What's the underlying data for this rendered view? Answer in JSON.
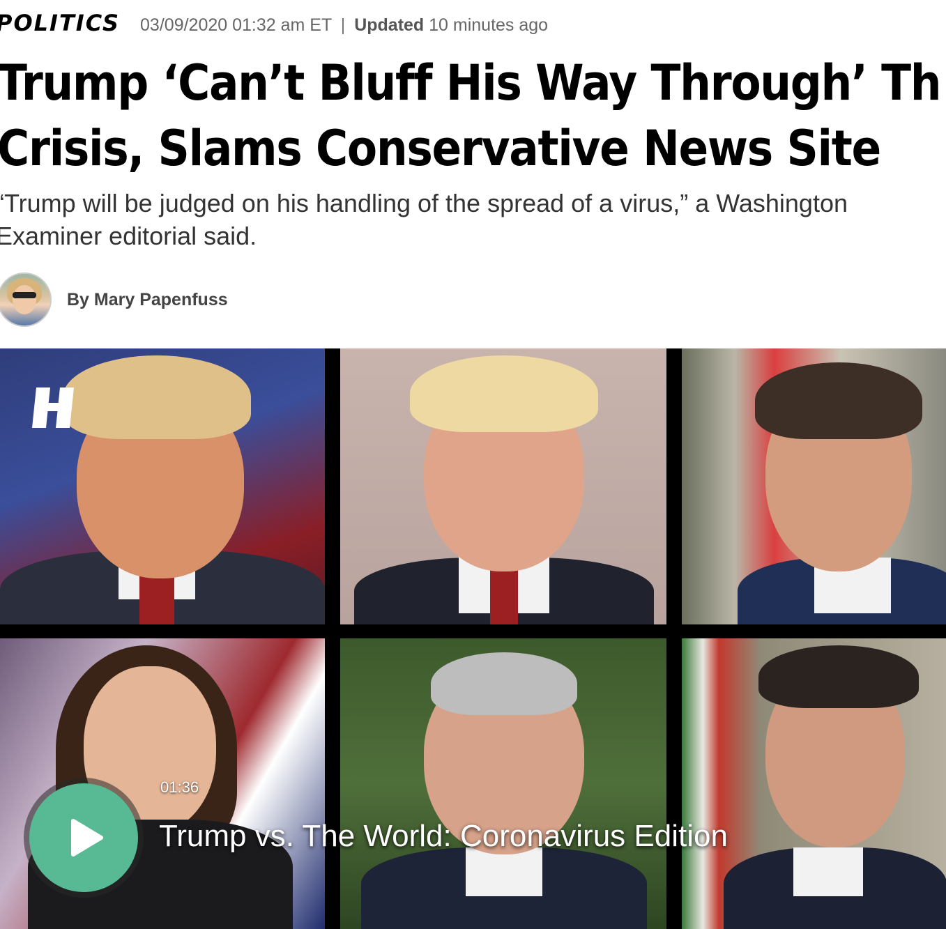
{
  "article": {
    "section": "POLITICS",
    "date": "03/09/2020 01:32 am ET",
    "separator": "|",
    "updated_label": "Updated",
    "updated_value": "10 minutes ago",
    "headline_line1": "Trump ‘Can’t Bluff His Way Through’ Th",
    "headline_line2": "Crisis, Slams Conservative News Site",
    "dek_line1": "“Trump will be judged on his handling of the spread of a virus,” a Washington",
    "dek_line2": "Examiner editorial said.",
    "byline": "By Mary Papenfuss"
  },
  "video": {
    "duration": "01:36",
    "title": "Trump vs. The World: Coronavirus Edition",
    "play_color": "#58b995"
  }
}
